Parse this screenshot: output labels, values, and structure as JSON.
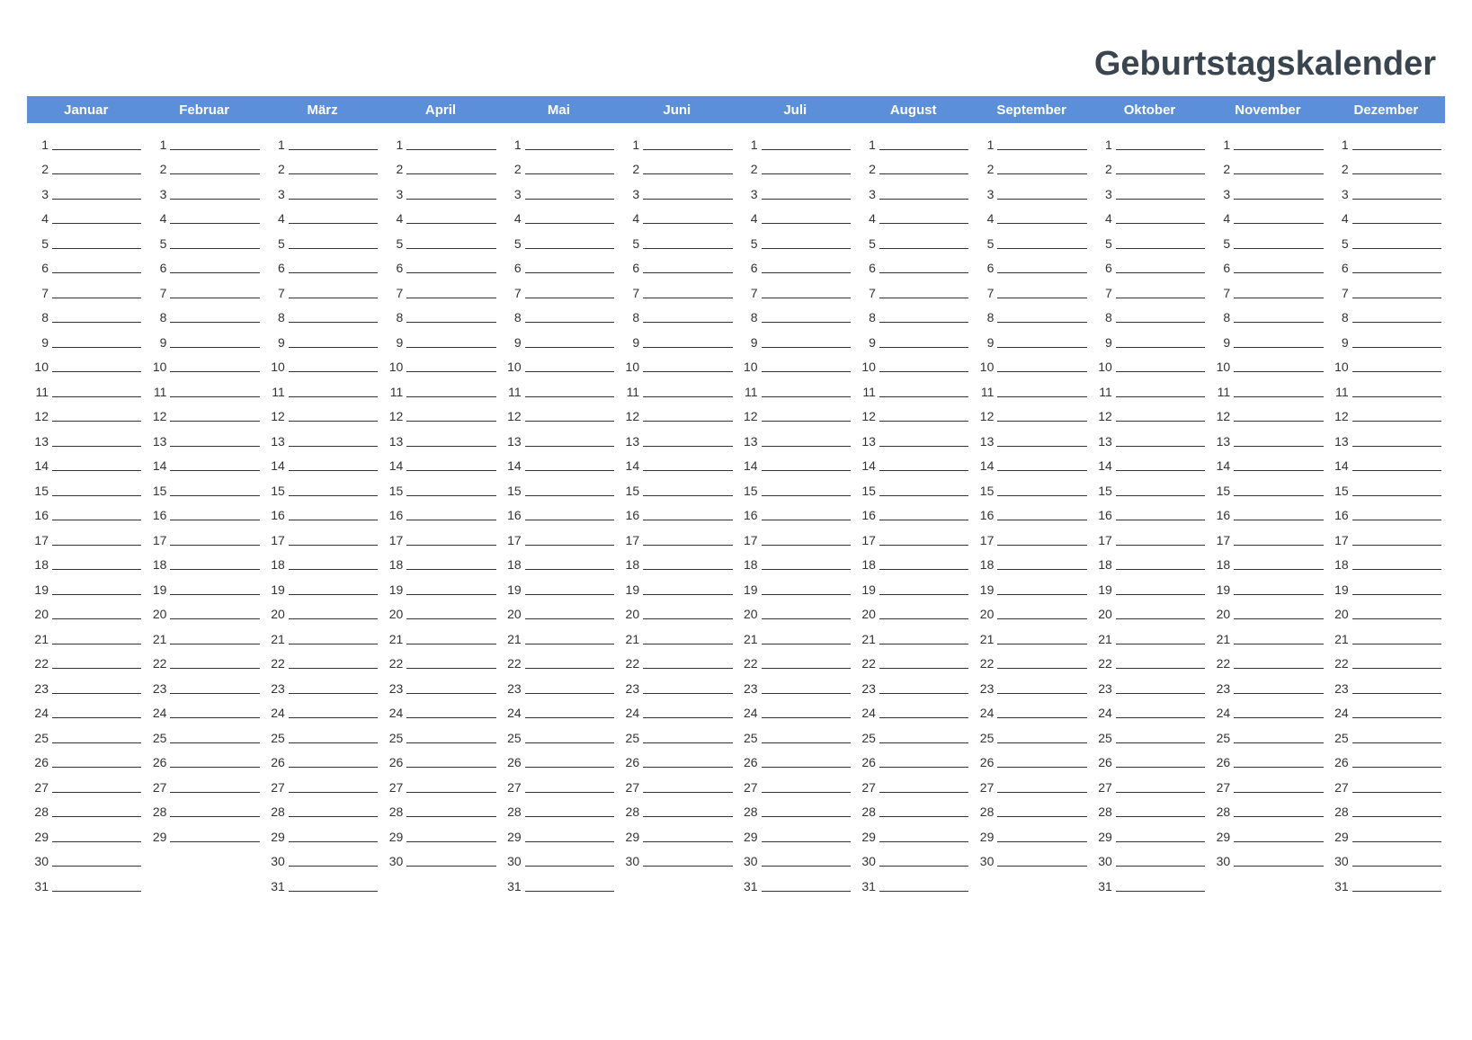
{
  "title": "Geburtstagskalender",
  "months": [
    {
      "name": "Januar",
      "days": 31
    },
    {
      "name": "Februar",
      "days": 29
    },
    {
      "name": "März",
      "days": 31
    },
    {
      "name": "April",
      "days": 30
    },
    {
      "name": "Mai",
      "days": 31
    },
    {
      "name": "Juni",
      "days": 30
    },
    {
      "name": "Juli",
      "days": 31
    },
    {
      "name": "August",
      "days": 31
    },
    {
      "name": "September",
      "days": 30
    },
    {
      "name": "Oktober",
      "days": 31
    },
    {
      "name": "November",
      "days": 30
    },
    {
      "name": "Dezember",
      "days": 31
    }
  ],
  "maxDays": 31,
  "colors": {
    "headerBg": "#5b8fd9",
    "headerText": "#ffffff",
    "titleText": "#3a4550",
    "lineColor": "#333333"
  }
}
